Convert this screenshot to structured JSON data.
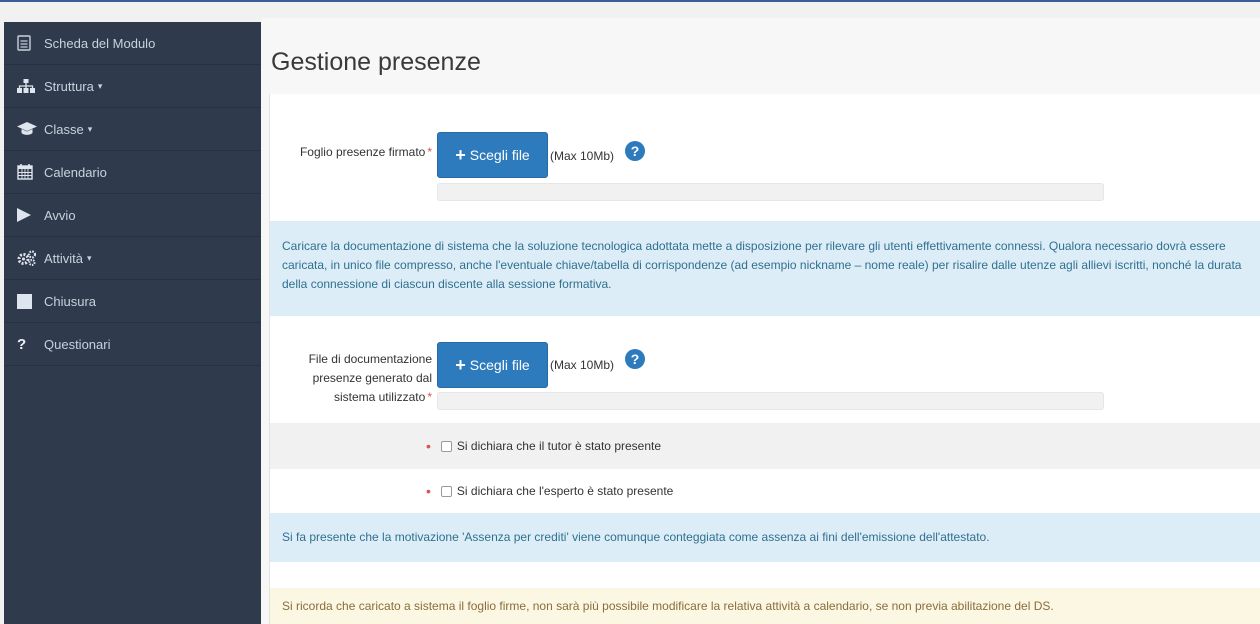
{
  "sidebar": {
    "items": [
      {
        "label": "Scheda del Modulo",
        "icon": "document-icon",
        "dropdown": false
      },
      {
        "label": "Struttura",
        "icon": "sitemap-icon",
        "dropdown": true
      },
      {
        "label": "Classe",
        "icon": "graduation-cap-icon",
        "dropdown": true
      },
      {
        "label": "Calendario",
        "icon": "calendar-icon",
        "dropdown": false
      },
      {
        "label": "Avvio",
        "icon": "play-icon",
        "dropdown": false
      },
      {
        "label": "Attività",
        "icon": "cogs-icon",
        "dropdown": true
      },
      {
        "label": "Chiusura",
        "icon": "square-icon",
        "dropdown": false
      },
      {
        "label": "Questionari",
        "icon": "question-icon",
        "dropdown": false
      }
    ],
    "caret": "▾"
  },
  "main": {
    "title": "Gestione presenze",
    "foglio": {
      "label": "Foglio presenze firmato",
      "required_mark": "*",
      "button_icon": "+",
      "button_label": "Scegli file",
      "max_note": "(Max 10Mb)",
      "help": "?"
    },
    "info_docs": "Caricare la documentazione di sistema che la soluzione tecnologica adottata mette a disposizione per rilevare gli utenti effettivamente connessi. Qualora necessario dovrà essere caricata, in unico file compresso, anche l'eventuale chiave/tabella di corrispondenze (ad esempio nickname – nome reale) per risalire dalle utenze agli allievi iscritti, nonché la durata della connessione di ciascun discente alla sessione formativa.",
    "file_doc": {
      "label": "File di documentazione presenze generato dal sistema utilizzato",
      "required_mark": "*",
      "button_icon": "+",
      "button_label": "Scegli file",
      "max_note": "(Max 10Mb)",
      "help": "?"
    },
    "checks": [
      {
        "mark": "•",
        "label": "Si dichiara che il tutor è stato presente",
        "checked": false
      },
      {
        "mark": "•",
        "label": "Si dichiara che l'esperto è stato presente",
        "checked": false
      }
    ],
    "info_assenza": "Si fa presente che la motivazione 'Assenza per crediti' viene comunque conteggiata come assenza ai fini dell'emissione dell'attestato.",
    "warning": "Si ricorda che caricato a sistema il foglio firme, non sarà più possibile modificare la relativa attività a calendario, se non previa abilitazione del DS."
  },
  "colors": {
    "sidebar_bg": "#2f3a4c",
    "button_primary": "#2d7bbd",
    "info_bg": "#dcedf7",
    "warning_bg": "#fbf7e3",
    "required": "#d9534f"
  }
}
